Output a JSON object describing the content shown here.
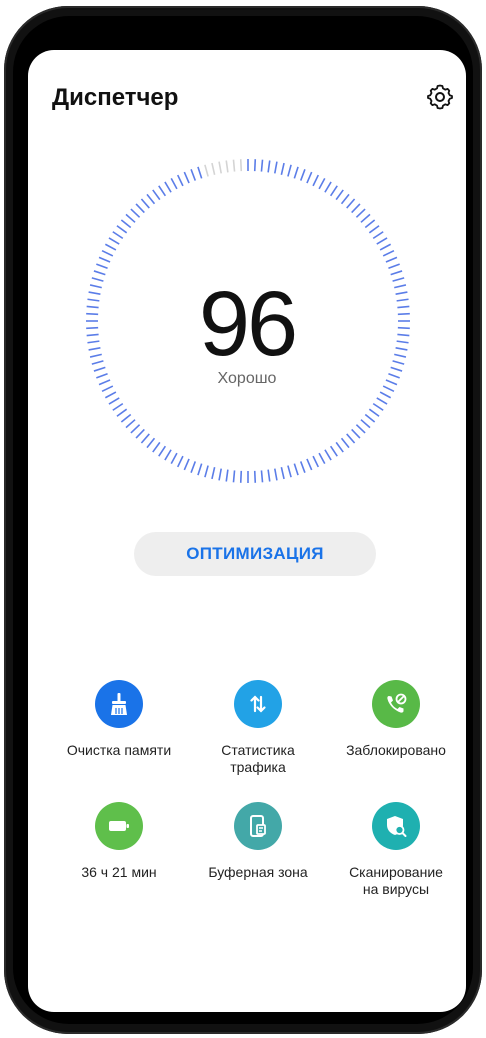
{
  "header": {
    "title": "Диспетчер",
    "settings_icon": "gear-icon"
  },
  "score": {
    "value": "96",
    "status": "Хорошо",
    "level_percent": 96
  },
  "optimize_button": {
    "label": "ОПТИМИЗАЦИЯ"
  },
  "colors": {
    "accent": "#1a73e8",
    "dial_blue": "#5b7de8",
    "dial_gray": "#d4d4d4"
  },
  "tools": [
    {
      "label": "Очистка памяти",
      "icon": "broom-icon",
      "color": "#1a73e8"
    },
    {
      "label": "Статистика трафика",
      "icon": "traffic-arrows-icon",
      "color": "#22a2e6"
    },
    {
      "label": "Заблокировано",
      "icon": "blocked-call-icon",
      "color": "#58b947"
    },
    {
      "label": "36 ч 21 мин",
      "icon": "battery-icon",
      "color": "#5fbf4b"
    },
    {
      "label": "Буферная зона",
      "icon": "phone-clipboard-icon",
      "color": "#43a8a8"
    },
    {
      "label": "Сканирование на вирусы",
      "icon": "shield-scan-icon",
      "color": "#1fb0b0"
    }
  ]
}
